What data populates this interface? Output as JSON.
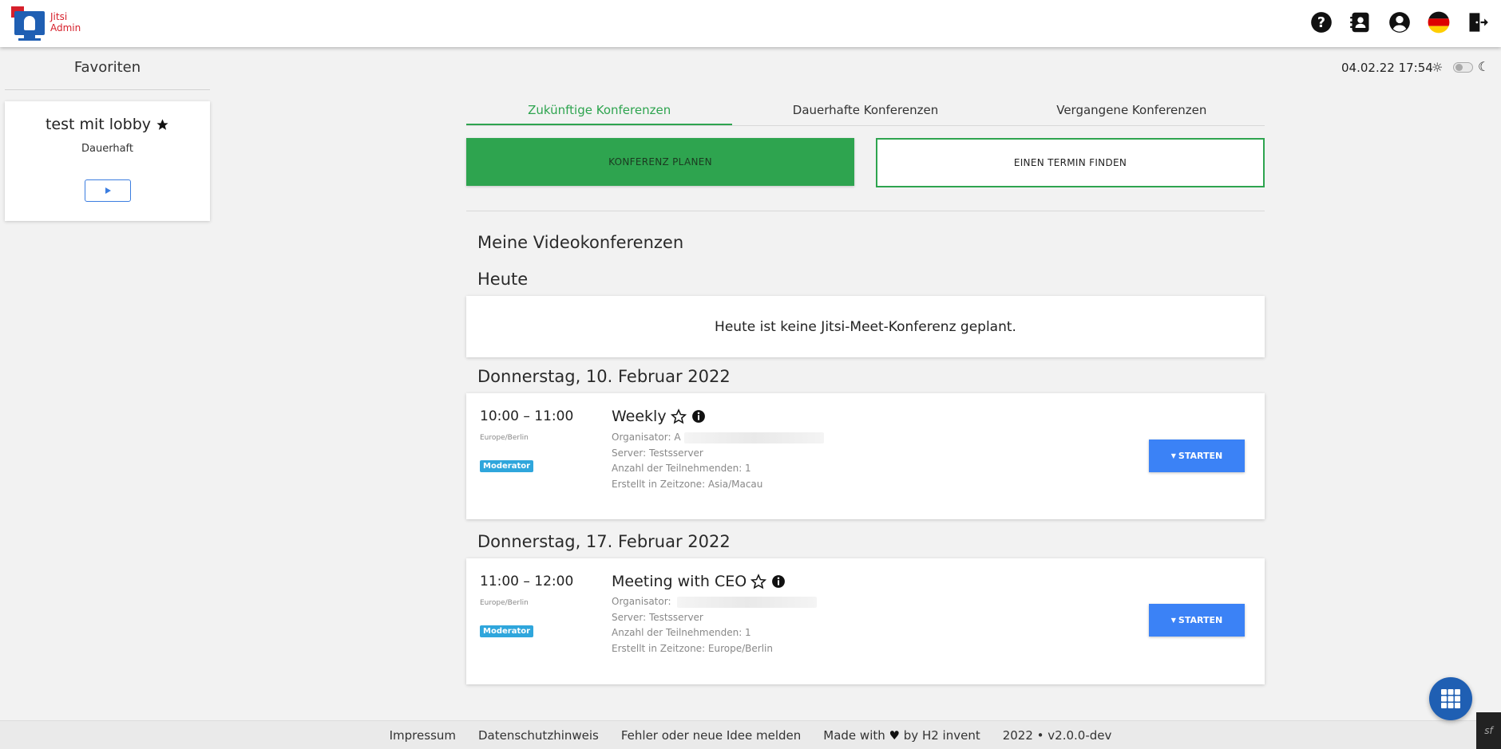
{
  "app": {
    "logo_line1": "Jitsi",
    "logo_line2": "Admin"
  },
  "header": {
    "icons": [
      "help-icon",
      "contacts-icon",
      "account-icon",
      "german-flag-icon",
      "logout-icon"
    ]
  },
  "sidebar": {
    "title": "Favoriten",
    "favorite": {
      "name": "test mit lobby",
      "type": "Dauerhaft"
    }
  },
  "status": {
    "datetime": "04.02.22 17:54"
  },
  "tabs": [
    {
      "label": "Zukünftige Konferenzen",
      "active": true
    },
    {
      "label": "Dauerhafte Konferenzen",
      "active": false
    },
    {
      "label": "Vergangene Konferenzen",
      "active": false
    }
  ],
  "actions": {
    "plan": "KONFERENZ PLANEN",
    "find": "EINEN TERMIN FINDEN"
  },
  "main": {
    "heading": "Meine Videokonferenzen",
    "today_heading": "Heute",
    "today_empty": "Heute ist keine Jitsi-Meet-Konferenz geplant.",
    "days": [
      {
        "date": "Donnerstag, 10. Februar 2022",
        "conference": {
          "time": "10:00 – 11:00",
          "timezone": "Europe/Berlin",
          "role": "Moderator",
          "title": "Weekly",
          "organizer_label": "Organisator:",
          "organizer_initial": "A",
          "server": "Server: Testsserver",
          "participants": "Anzahl der Teilnehmenden: 1",
          "created_tz": "Erstellt in Zeitzone: Asia/Macau",
          "start": "STARTEN"
        }
      },
      {
        "date": "Donnerstag, 17. Februar 2022",
        "conference": {
          "time": "11:00 – 12:00",
          "timezone": "Europe/Berlin",
          "role": "Moderator",
          "title": "Meeting with CEO",
          "organizer_label": "Organisator:",
          "organizer_initial": "",
          "server": "Server: Testsserver",
          "participants": "Anzahl der Teilnehmenden: 1",
          "created_tz": "Erstellt in Zeitzone: Europe/Berlin",
          "start": "STARTEN"
        }
      }
    ]
  },
  "footer": {
    "impressum": "Impressum",
    "privacy": "Datenschutzhinweis",
    "feedback": "Fehler oder neue Idee melden",
    "made_pre": "Made with",
    "made_post": "by H2 invent",
    "version": "2022 • v2.0.0-dev"
  },
  "colors": {
    "green": "#2ea44f",
    "blue": "#3b82f6",
    "badge": "#2fa6dc",
    "brand": "#1f5fb3",
    "brand_red": "#d6202b"
  }
}
